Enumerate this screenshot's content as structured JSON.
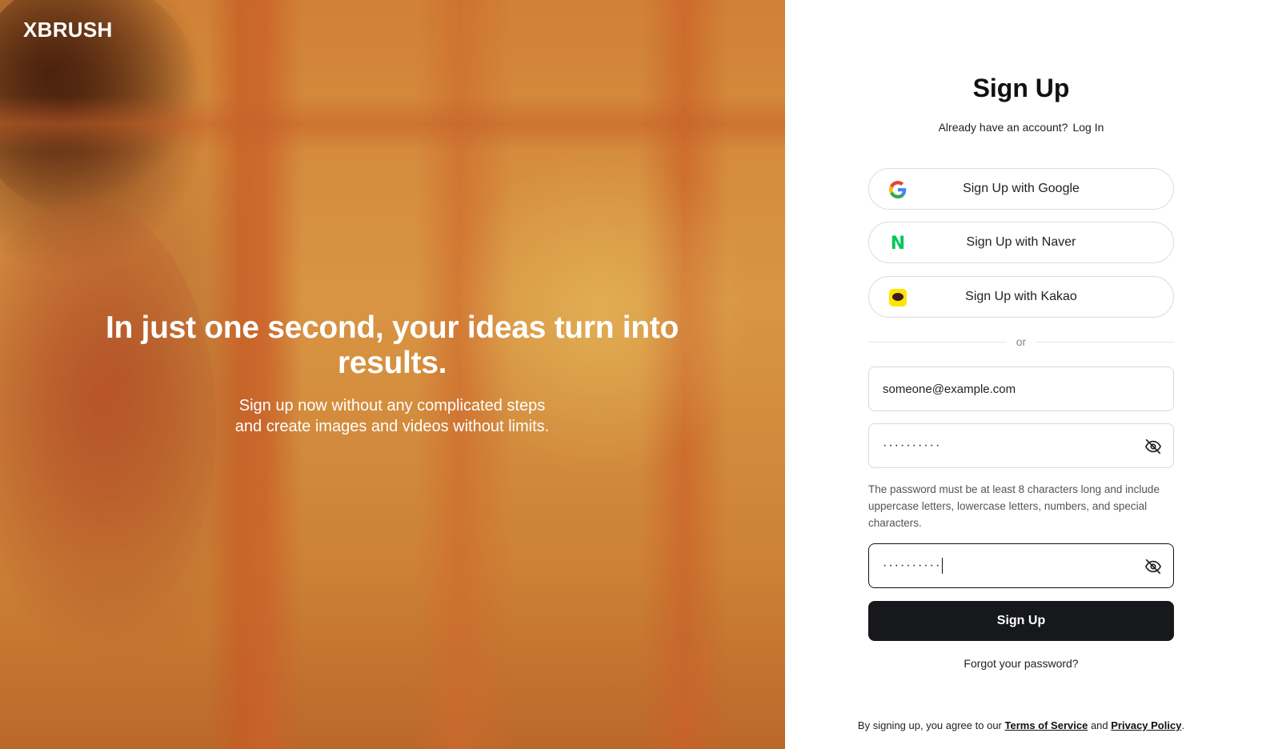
{
  "hero": {
    "logo": "XBRUSH",
    "headline": "In just one second, your ideas turn into results.",
    "subline_1": "Sign up now without any complicated steps",
    "subline_2": "and create images and videos without limits."
  },
  "signup": {
    "title": "Sign Up",
    "have_account": "Already have an account?",
    "login_link": "Log In",
    "google": "Sign Up with Google",
    "naver": "Sign Up with Naver",
    "naver_icon": "N",
    "kakao": "Sign Up with Kakao",
    "or": "or",
    "email_value": "someone@example.com",
    "password_value": "··········",
    "password_confirm_value": "··········",
    "password_hint": "The password must be at least 8 characters long and include uppercase letters, lowercase letters, numbers, and special characters.",
    "submit": "Sign Up",
    "forgot": "Forgot your password?",
    "terms_prefix": "By signing up, you agree to our",
    "terms_link": "Terms of Service",
    "terms_and": "and",
    "privacy_link": "Privacy Policy",
    "terms_suffix": "."
  },
  "colors": {
    "primary_button": "#17181c",
    "naver_green": "#03c75a",
    "kakao_yellow": "#fee500"
  },
  "icons": {
    "google": "google-logo-icon",
    "naver": "naver-logo-icon",
    "kakao": "kakao-logo-icon",
    "password_toggle": "eye-off-icon"
  }
}
